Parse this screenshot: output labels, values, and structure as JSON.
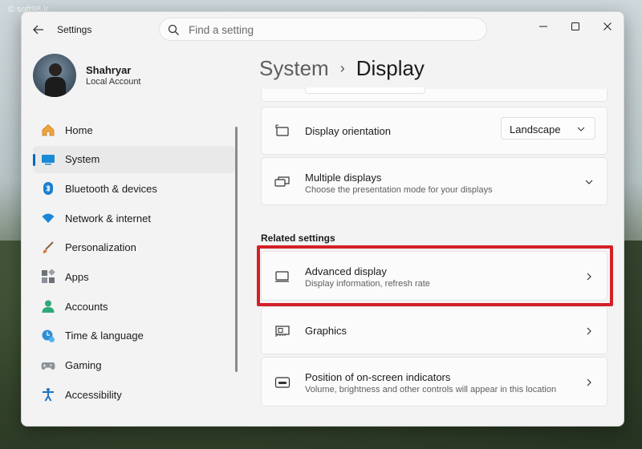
{
  "watermark": "© soft98.ir",
  "app": {
    "title": "Settings",
    "search_placeholder": "Find a setting"
  },
  "user": {
    "name": "Shahryar",
    "account_type": "Local Account"
  },
  "sidebar": {
    "items": [
      {
        "label": "Home",
        "icon": "home-icon",
        "active": false
      },
      {
        "label": "System",
        "icon": "system-icon",
        "active": true
      },
      {
        "label": "Bluetooth & devices",
        "icon": "bluetooth-icon",
        "active": false
      },
      {
        "label": "Network & internet",
        "icon": "network-icon",
        "active": false
      },
      {
        "label": "Personalization",
        "icon": "personalization-icon",
        "active": false
      },
      {
        "label": "Apps",
        "icon": "apps-icon",
        "active": false
      },
      {
        "label": "Accounts",
        "icon": "accounts-icon",
        "active": false
      },
      {
        "label": "Time & language",
        "icon": "time-language-icon",
        "active": false
      },
      {
        "label": "Gaming",
        "icon": "gaming-icon",
        "active": false
      },
      {
        "label": "Accessibility",
        "icon": "accessibility-icon",
        "active": false
      }
    ]
  },
  "breadcrumb": {
    "parent": "System",
    "separator": "›",
    "current": "Display"
  },
  "settings": {
    "orientation": {
      "title": "Display orientation",
      "value": "Landscape",
      "icon": "orientation-icon"
    },
    "multiple_displays": {
      "title": "Multiple displays",
      "subtitle": "Choose the presentation mode for your displays",
      "icon": "multiple-displays-icon"
    }
  },
  "related": {
    "heading": "Related settings",
    "items": [
      {
        "title": "Advanced display",
        "subtitle": "Display information, refresh rate",
        "icon": "monitor-icon",
        "highlighted": true
      },
      {
        "title": "Graphics",
        "subtitle": "",
        "icon": "graphics-card-icon",
        "highlighted": false
      },
      {
        "title": "Position of on-screen indicators",
        "subtitle": "Volume, brightness and other controls will appear in this location",
        "icon": "onscreen-indicator-icon",
        "highlighted": false
      }
    ]
  },
  "colors": {
    "accent": "#0067c0",
    "highlight": "#d32027"
  }
}
